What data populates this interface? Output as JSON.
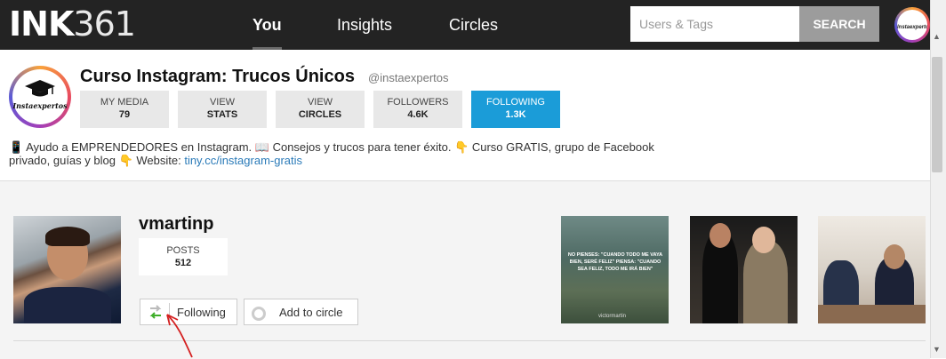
{
  "header": {
    "logo_ink": "INK",
    "logo_num": "361",
    "nav": [
      {
        "label": "You",
        "active": true
      },
      {
        "label": "Insights",
        "active": false
      },
      {
        "label": "Circles",
        "active": false
      }
    ],
    "search": {
      "placeholder": "Users & Tags",
      "button": "SEARCH"
    },
    "avatar_brand": "Instaexpertos"
  },
  "profile": {
    "name": "Curso Instagram: Trucos Únicos",
    "handle": "@instaexpertos",
    "avatar_brand": "Instaexpertos",
    "stats": [
      {
        "label": "MY MEDIA",
        "value": "79",
        "active": false
      },
      {
        "label": "VIEW",
        "value": "STATS",
        "active": false
      },
      {
        "label": "VIEW",
        "value": "CIRCLES",
        "active": false
      },
      {
        "label": "FOLLOWERS",
        "value": "4.6K",
        "active": false
      },
      {
        "label": "FOLLOWING",
        "value": "1.3K",
        "active": true
      }
    ],
    "bio_line1": "📱 Ayudo a EMPRENDEDORES en Instagram. 📖 Consejos y trucos para tener éxito. 👇 Curso GRATIS, grupo de Facebook",
    "bio_line2": "privado, guías y blog 👇 Website: ",
    "bio_link": "tiny.cc/instagram-gratis"
  },
  "user_card": {
    "username": "vmartinp",
    "posts_label": "POSTS",
    "posts_value": "512",
    "following_button": "Following",
    "add_circle_button": "Add to circle",
    "thumb1_text": "NO PIENSES: \"CUANDO TODO ME VAYA BIEN, SERÉ FELIZ\" PIENSA: \"CUANDO SEA FELIZ, TODO ME IRÁ BIEN\"",
    "thumb1_credit": "victormartin"
  },
  "colors": {
    "topbar": "#232323",
    "accent": "#1b9cd8",
    "search_button": "#9c9c9c",
    "annotation_arrow": "#d42020"
  }
}
